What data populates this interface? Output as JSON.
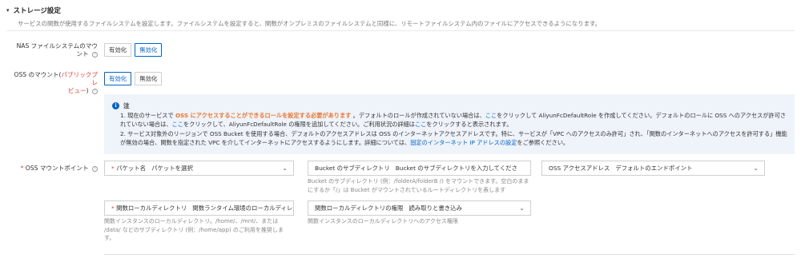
{
  "section": {
    "title": "ストレージ設定",
    "description": "サービスの関数が使用するファイルシステムを設定します。ファイルシステムを設定すると、関数がオンプレミスのファイルシステムと同様に、リモートファイルシステム内のファイルにアクセスできるようになります。"
  },
  "nas": {
    "label_line1": "NAS ファイルシステムのマウ",
    "label_line2": "ント",
    "help": "?",
    "enable_label": "有効化",
    "disable_label": "無効化",
    "selected": "無効化"
  },
  "oss": {
    "label_prefix": "OSS のマウント(",
    "label_red1": "パブリックプレ",
    "label_red2": "ビュー",
    "label_suffix": ")",
    "help": "?",
    "enable_label": "有効化",
    "disable_label": "無効化",
    "selected": "有効化"
  },
  "notice": {
    "title": "注",
    "line1_a": "1. 現在のサービスで ",
    "line1_hl": "OSS にアクセスすることができるロールを設定する必要があります",
    "line1_b": " 。デフォルトのロールが作成されていない場合は、",
    "line1_link1": "ここ",
    "line1_c": "をクリックして AliyunFcDefaultRole を作成してください。デフォルトのロールに OSS へのアクセスが許可されていない場合は、",
    "line1_link2": "ここ",
    "line1_d": "をクリックして、AliyunFcDefaultRole の権限を追加してください。ご利用状況の詳細は",
    "line1_link3": "ここ",
    "line1_e": "をクリックすると表示されます。",
    "line2_a": "2. サービス対象外のリージョンで OSS Bucket を使用する場合、デフォルトのアクセスアドレスは OSS のインターネットアクセスアドレスです。特に、サービスが「VPC へのアクセスのみ許可」され、「関数のインターネットへのアクセスを許可する」機能が無効の場合、関数を指定された VPC を介してインターネットにアクセスするようにします。詳細については、",
    "line2_link": "固定のインターネット IP アドレスの設定",
    "line2_b": "をご参照ください。"
  },
  "mount": {
    "label": "OSS マウントポイント",
    "required_mark": "*",
    "help": "?",
    "bucket_label": "パケット名",
    "bucket_placeholder": "パケットを選択",
    "subdir_label": "Bucket のサブディレクトリ",
    "subdir_placeholder": "Bucket のサブディレクトリを入力してくださ",
    "subdir_hint": "Bucket のサブディレクトリ (例：/folderA/folderB /) をマウントできます。空白のままにするか「/」は Bucket がマウントされているルートディレクトリを表します",
    "endpoint_label": "OSS アクセスアドレス",
    "endpoint_value": "デフォルトのエンドポイント",
    "localdir_label": "関数ローカルディレクトリ",
    "localdir_placeholder": "関数ランタイム環境のローカルディレク",
    "localdir_hint": "関数インスタンスのローカルディレクトリ。/home/、/mnt/、または /data/ などのサブディレクトリ (例：/home/app) のご利用を推奨します。",
    "permission_label": "関数ローカルディレクトリの権限",
    "permission_value": "読み取りと書き込み",
    "permission_hint": "関数インスタンスのローカルディレクトリへのアクセス権限"
  },
  "icons": {
    "collapse": "chevron-down-icon",
    "help": "question-circle-icon",
    "info": "info-circle-icon",
    "dropdown": "chevron-down-icon"
  },
  "colors": {
    "accent": "#0064c8",
    "warning": "#e8762d",
    "required": "#e23c39",
    "notice_bg": "#eff3fa"
  }
}
